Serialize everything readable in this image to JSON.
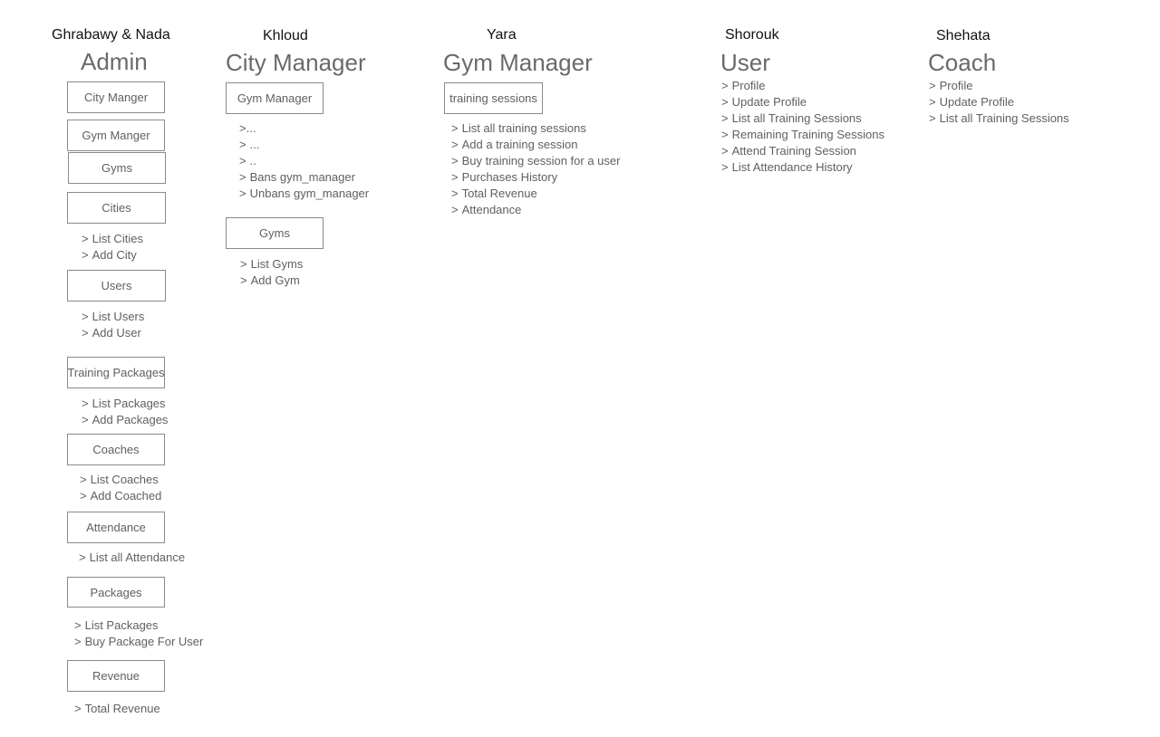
{
  "admin": {
    "person": "Ghrabawy & Nada",
    "role": "Admin",
    "boxes": {
      "city_manger": "City Manger",
      "gym_manger": "Gym Manger",
      "gyms": "Gyms",
      "cities": "Cities",
      "users": "Users",
      "training_packages": "Training Packages",
      "coaches": "Coaches",
      "attendance": "Attendance",
      "packages": "Packages",
      "revenue": "Revenue"
    },
    "lists": {
      "cities": [
        "List Cities",
        "Add City"
      ],
      "users": [
        "List Users",
        "Add User"
      ],
      "training_packages": [
        "List Packages",
        "Add Packages"
      ],
      "coaches": [
        "List Coaches",
        "Add Coached"
      ],
      "attendance": [
        "List all Attendance"
      ],
      "packages": [
        "List Packages",
        "Buy Package For User"
      ],
      "revenue": [
        "Total Revenue"
      ]
    }
  },
  "city_manager": {
    "person": "Khloud",
    "role": "City Manager",
    "boxes": {
      "gym_manager": "Gym Manager",
      "gyms": "Gyms"
    },
    "lists": {
      "gym_manager": [
        "...",
        "...",
        "..",
        "Bans gym_manager",
        "Unbans gym_manager"
      ],
      "gyms": [
        "List Gyms",
        "Add Gym"
      ]
    }
  },
  "gym_manager": {
    "person": "Yara",
    "role": "Gym Manager",
    "boxes": {
      "training_sessions": "training sessions"
    },
    "lists": {
      "training_sessions": [
        "List all training sessions",
        "Add a training session",
        "Buy training session for a user",
        "Purchases History",
        "Total Revenue",
        "Attendance"
      ]
    }
  },
  "user": {
    "person": "Shorouk",
    "role": "User",
    "lists": {
      "main": [
        "Profile",
        "Update Profile",
        "List all Training Sessions",
        "Remaining Training Sessions",
        "Attend Training Session",
        "List Attendance History"
      ]
    }
  },
  "coach": {
    "person": "Shehata",
    "role": "Coach",
    "lists": {
      "main": [
        "Profile",
        "Update Profile",
        "List all Training Sessions"
      ]
    }
  },
  "bullet": ">"
}
